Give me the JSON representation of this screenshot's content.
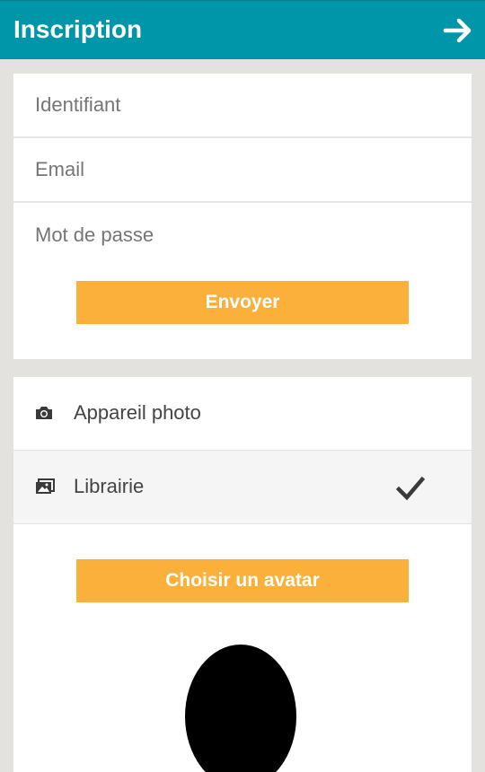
{
  "header": {
    "title": "Inscription",
    "next_icon": "arrow-right-icon",
    "background_color": "#0096aa"
  },
  "form": {
    "fields": [
      {
        "placeholder": "Identifiant",
        "value": ""
      },
      {
        "placeholder": "Email",
        "value": ""
      },
      {
        "placeholder": "Mot de passe",
        "value": ""
      }
    ],
    "submit_label": "Envoyer"
  },
  "avatar_source": {
    "options": [
      {
        "label": "Appareil photo",
        "icon": "camera-icon",
        "selected": false
      },
      {
        "label": "Librairie",
        "icon": "image-library-icon",
        "selected": true
      }
    ],
    "selected_icon": "checkmark-icon",
    "choose_label": "Choisir un avatar"
  },
  "colors": {
    "accent": "#fbb03b",
    "page_background": "#e4e2df"
  }
}
